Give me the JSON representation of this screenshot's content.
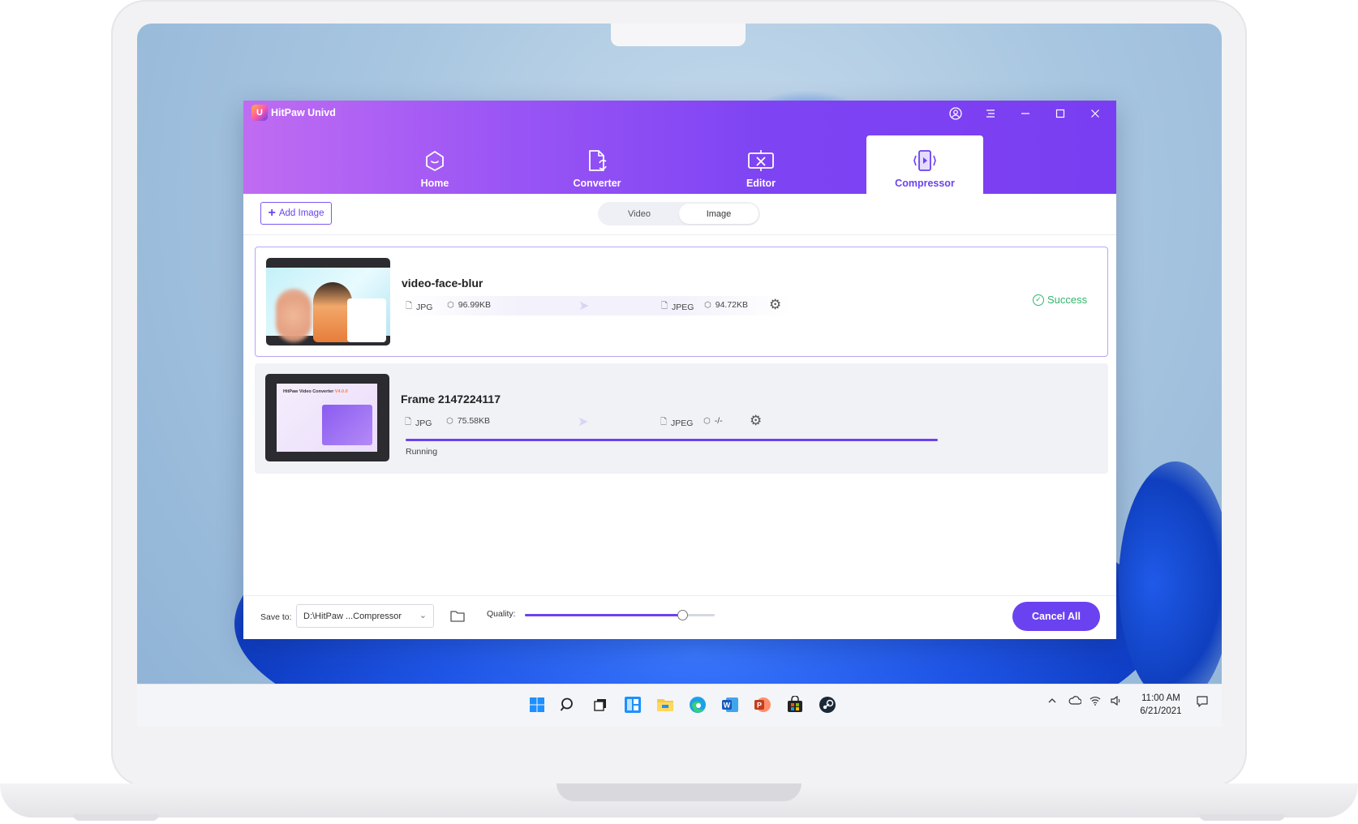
{
  "app": {
    "title": "HitPaw Univd",
    "logo_letter": "U",
    "accent_color": "#6b42f0",
    "header_gradient": [
      "#c06cf2",
      "#7a3ef2"
    ]
  },
  "nav": {
    "tabs": [
      {
        "label": "Home",
        "icon": "home-icon"
      },
      {
        "label": "Converter",
        "icon": "converter-icon"
      },
      {
        "label": "Editor",
        "icon": "editor-icon"
      },
      {
        "label": "Compressor",
        "icon": "compressor-icon",
        "active": true
      }
    ]
  },
  "toolbar": {
    "add_label": "Add Image",
    "segment": {
      "options": [
        "Video",
        "Image"
      ],
      "selected": "Image"
    }
  },
  "items": [
    {
      "name": "video-face-blur",
      "source_format": "JPG",
      "source_size": "96.99KB",
      "target_format": "JPEG",
      "target_size": "94.72KB",
      "status": "Success"
    },
    {
      "name": "Frame 2147224117",
      "source_format": "JPG",
      "source_size": "75.58KB",
      "target_format": "JPEG",
      "target_size": "-/-",
      "status": "Running",
      "progress": 1.0,
      "thumb_title_a": "HitPaw Video Converter",
      "thumb_title_b": "V4.0.0"
    }
  ],
  "footer": {
    "save_label": "Save to:",
    "save_path": "D:\\HitPaw ...Compressor",
    "quality_label": "Quality:",
    "quality_value": 0.83,
    "cancel_label": "Cancel All"
  },
  "taskbar": {
    "time": "11:00 AM",
    "date": "6/21/2021",
    "icons": [
      "windows-start-icon",
      "search-icon",
      "task-view-icon",
      "widgets-icon",
      "file-explorer-icon",
      "edge-icon",
      "word-icon",
      "powerpoint-icon",
      "store-icon",
      "steam-icon"
    ],
    "tray": [
      "chevron-up-icon",
      "onedrive-icon",
      "wifi-icon",
      "volume-icon",
      "notification-icon"
    ]
  }
}
